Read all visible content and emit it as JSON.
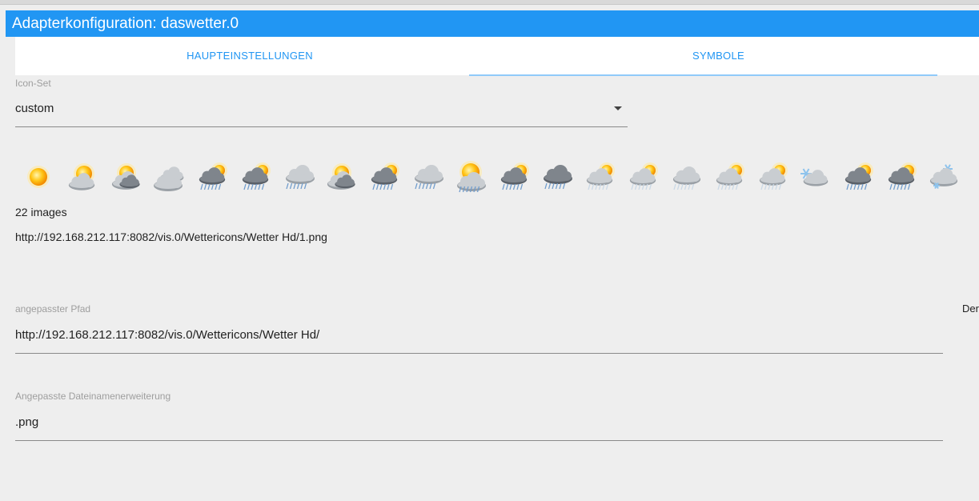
{
  "window": {
    "title": "Adapterkonfiguration: daswetter.0"
  },
  "tabs": [
    {
      "label": "HAUPTEINSTELLUNGEN",
      "active": false
    },
    {
      "label": "SYMBOLE",
      "active": true
    }
  ],
  "icon_set": {
    "label": "Icon-Set",
    "value": "custom"
  },
  "weather_icons": [
    "sun-icon",
    "sun-cloud-icon",
    "sun-clouds-icon",
    "clouds-icon",
    "rain-sun-icon",
    "rain-sun-icon",
    "rain-cloud-icon",
    "sun-clouds-icon",
    "rain-sun-icon",
    "rain-cloud-icon",
    "sun-rain-icon",
    "rain-sun-icon",
    "storm-rain-icon",
    "light-rain-sun-icon",
    "light-rain-sun-icon",
    "light-rain-cloud-icon",
    "light-rain-sun-icon",
    "light-rain-sun-icon",
    "snow-icon",
    "rain-sun-icon",
    "rain-sun-icon",
    "snow-cloud-icon"
  ],
  "images_count": "22 images",
  "preview_path": "http://192.168.212.117:8082/vis.0/Wettericons/Wetter Hd/1.png",
  "custom_path": {
    "label": "angepasster Pfad",
    "value": "http://192.168.212.117:8082/vis.0/Wettericons/Wetter Hd/"
  },
  "file_extension": {
    "label": "Angepasste Dateinamenerweiterung",
    "value": ".png"
  },
  "side_hint": "Der",
  "colors": {
    "accent": "#2196f3",
    "background": "#eeeeee",
    "tab_indicator": "#90caf9"
  }
}
